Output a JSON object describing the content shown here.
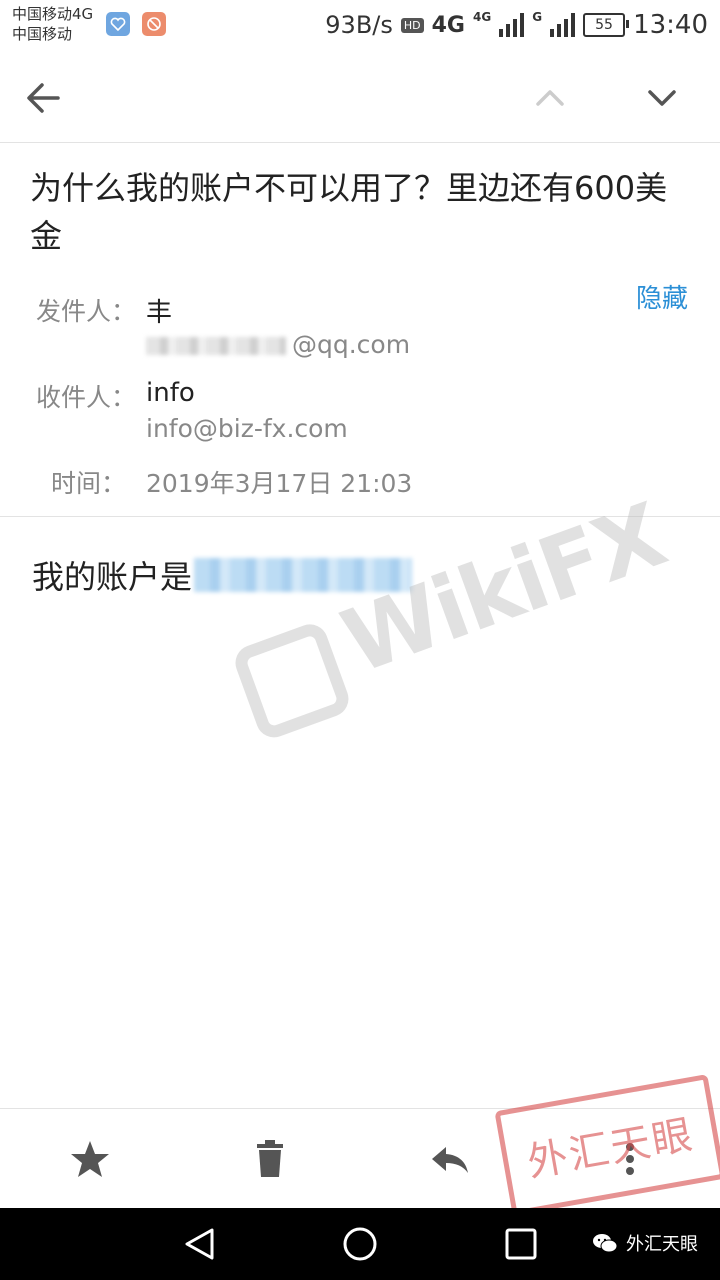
{
  "status_bar": {
    "carrier_line1": "中国移动4G",
    "carrier_line2": "中国移动",
    "speed": "93B/s",
    "hd": "HD",
    "net1": "4G",
    "net2": "4G",
    "net3": "G",
    "battery": "55",
    "time": "13:40"
  },
  "toolbar": {
    "back_icon": "arrow-left-icon",
    "prev_icon": "chevron-up-icon",
    "next_icon": "chevron-down-icon"
  },
  "email": {
    "subject": "为什么我的账户不可以用了？里边还有600美金",
    "hide_label": "隐藏",
    "from_label": "发件人：",
    "from_name": "丰",
    "from_email_suffix": "@qq.com",
    "to_label": "收件人：",
    "to_name": "info",
    "to_email": "info@biz-fx.com",
    "time_label": "时间：",
    "time_value": "2019年3月17日 21:03",
    "body_prefix": "我的账户是"
  },
  "watermark": {
    "text": "WikiFX"
  },
  "actions": {
    "star_icon": "star-icon",
    "delete_icon": "trash-icon",
    "reply_icon": "reply-icon",
    "more_icon": "more-vertical-icon"
  },
  "stamp": {
    "text": "外汇天眼"
  },
  "nav_bar": {
    "wechat_label": "外汇天眼"
  },
  "colors": {
    "link": "#2b8fd6",
    "stamp": "#d64a4a",
    "nav_bg": "#000000"
  }
}
